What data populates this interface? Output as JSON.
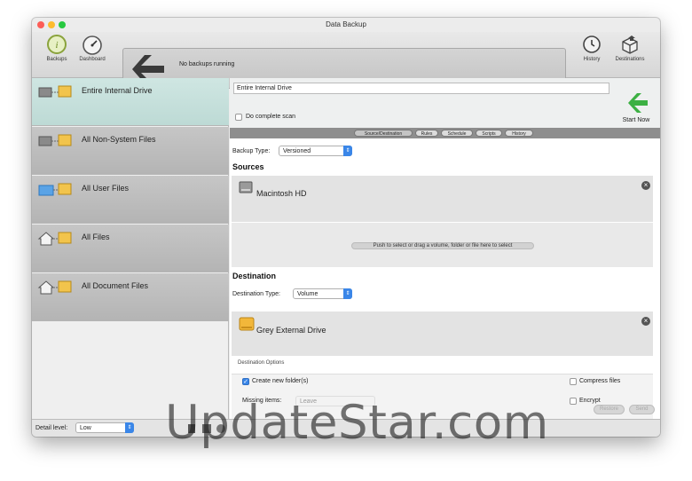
{
  "window": {
    "title": "Data Backup"
  },
  "toolbar": {
    "backups_label": "Backups",
    "dashboard_label": "Dashboard",
    "status_text": "No backups running",
    "history_label": "History",
    "destinations_label": "Destinations"
  },
  "sidebar": {
    "items": [
      {
        "label": "Entire Internal Drive",
        "icon": "drive-backup-icon",
        "selected": true
      },
      {
        "label": "All Non-System Files",
        "icon": "drive-backup-icon",
        "selected": false
      },
      {
        "label": "All User Files",
        "icon": "user-folder-backup-icon",
        "selected": false
      },
      {
        "label": "All Files",
        "icon": "home-backup-icon",
        "selected": false
      },
      {
        "label": "All Document Files",
        "icon": "home-backup-icon",
        "selected": false
      }
    ]
  },
  "footer": {
    "detail_label": "Detail level:",
    "detail_value": "Low",
    "restore_label": "Restore",
    "send_label": "Send"
  },
  "main": {
    "backup_name": "Entire Internal Drive",
    "complete_scan_label": "Do complete scan",
    "complete_scan_checked": false,
    "start_label": "Start Now",
    "tabs": [
      {
        "label": "Source/Destination",
        "selected": true
      },
      {
        "label": "Rules",
        "selected": false
      },
      {
        "label": "Schedule",
        "selected": false
      },
      {
        "label": "Scripts",
        "selected": false
      },
      {
        "label": "History",
        "selected": false
      }
    ],
    "backup_type_label": "Backup Type:",
    "backup_type_value": "Versioned",
    "sources_heading": "Sources",
    "source_name": "Macintosh HD",
    "source_hint": "Push to select or drag a volume, folder or file here to select",
    "destination_heading": "Destination",
    "destination_type_label": "Destination Type:",
    "destination_type_value": "Volume",
    "destination_name": "Grey External Drive",
    "options_label": "Destination Options",
    "create_folder_label": "Create new folder(s)",
    "create_folder_checked": true,
    "compress_label": "Compress files",
    "compress_checked": false,
    "missing_items_label": "Missing items:",
    "missing_items_value": "Leave",
    "encrypt_label": "Encrypt",
    "encrypt_checked": false
  },
  "watermark": "UpdateStar.com",
  "colors": {
    "accent": "#3a86e8",
    "start_green": "#3cb043",
    "selected_row": "#c8e0dc"
  }
}
